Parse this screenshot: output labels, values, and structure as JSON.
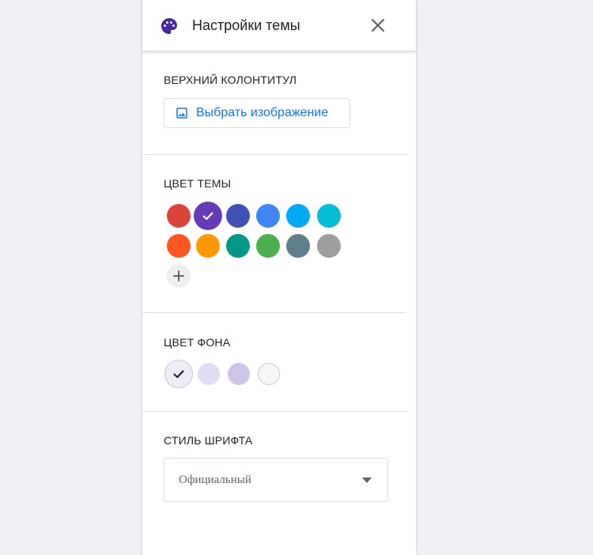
{
  "header": {
    "title": "Настройки темы",
    "icon": "palette-icon",
    "close_icon": "close-icon"
  },
  "sections": {
    "header_image": {
      "label": "ВЕРХНИЙ КОЛОНТИТУЛ",
      "button_label": "Выбрать изображение"
    },
    "theme_color": {
      "label": "ЦВЕТ ТЕМЫ",
      "colors": [
        "#db4437",
        "#673ab7",
        "#3f51b5",
        "#4285f4",
        "#03a9f4",
        "#00bcd4",
        "#ff5722",
        "#ff9800",
        "#009688",
        "#4caf50",
        "#607d8b",
        "#9e9e9e"
      ],
      "selected_index": 1,
      "add_icon": "plus-icon"
    },
    "background_color": {
      "label": "ЦВЕТ ФОНА",
      "colors": [
        "#efecf5",
        "#e1daf0",
        "#d1c4e9",
        "#f6f6f6"
      ],
      "selected_index": 0
    },
    "font_style": {
      "label": "СТИЛЬ ШРИФТА",
      "selected_value": "Официальный"
    }
  }
}
